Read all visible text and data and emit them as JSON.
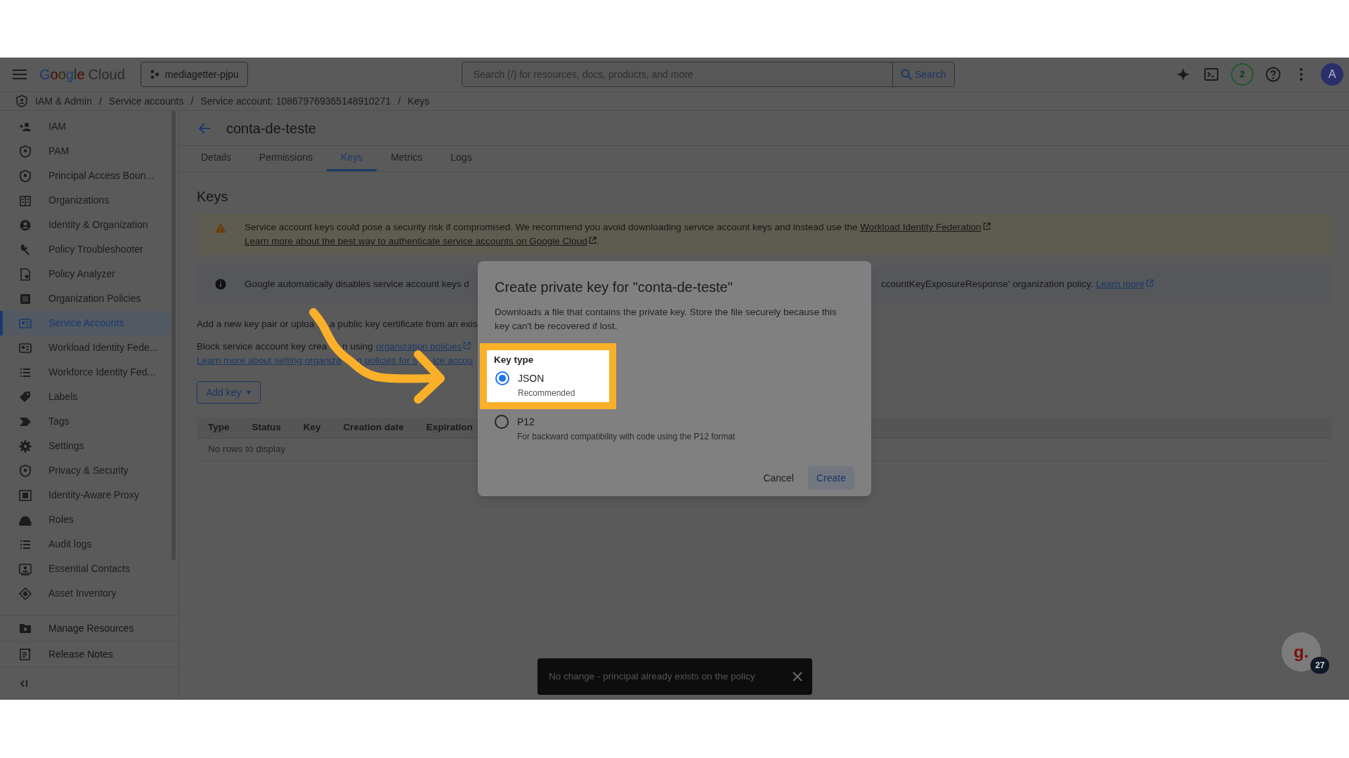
{
  "header": {
    "logo_brand": "Google",
    "logo_product": "Cloud",
    "project": "mediagetter-pjpu",
    "search_placeholder": "Search (/) for resources, docs, products, and more",
    "search_button": "Search",
    "notifications": "2",
    "avatar": "A"
  },
  "breadcrumbs": {
    "separator": "/",
    "items": [
      "IAM & Admin",
      "Service accounts",
      "Service account: 108679769365148910271",
      "Keys"
    ]
  },
  "sidebar": {
    "items": [
      {
        "label": "IAM",
        "selected": false
      },
      {
        "label": "PAM",
        "selected": false
      },
      {
        "label": "Principal Access Boun...",
        "selected": false
      },
      {
        "label": "Organizations",
        "selected": false
      },
      {
        "label": "Identity & Organization",
        "selected": false
      },
      {
        "label": "Policy Troubleshooter",
        "selected": false
      },
      {
        "label": "Policy Analyzer",
        "selected": false
      },
      {
        "label": "Organization Policies",
        "selected": false
      },
      {
        "label": "Service Accounts",
        "selected": true
      },
      {
        "label": "Workload Identity Fede...",
        "selected": false
      },
      {
        "label": "Workforce Identity Fed...",
        "selected": false
      },
      {
        "label": "Labels",
        "selected": false
      },
      {
        "label": "Tags",
        "selected": false
      },
      {
        "label": "Settings",
        "selected": false
      },
      {
        "label": "Privacy & Security",
        "selected": false
      },
      {
        "label": "Identity-Aware Proxy",
        "selected": false
      },
      {
        "label": "Roles",
        "selected": false
      },
      {
        "label": "Audit logs",
        "selected": false
      },
      {
        "label": "Essential Contacts",
        "selected": false
      },
      {
        "label": "Asset Inventory",
        "selected": false
      }
    ],
    "footer": [
      "Manage Resources",
      "Release Notes"
    ]
  },
  "page": {
    "title": "conta-de-teste",
    "tabs": [
      {
        "label": "Details",
        "selected": false
      },
      {
        "label": "Permissions",
        "selected": false
      },
      {
        "label": "Keys",
        "selected": true
      },
      {
        "label": "Metrics",
        "selected": false
      },
      {
        "label": "Logs",
        "selected": false
      }
    ],
    "heading": "Keys",
    "warning": {
      "text": "Service account keys could pose a security risk if compromised. We recommend you avoid downloading service account keys and instead use the",
      "links": [
        "Workload Identity Federation",
        "Learn more about the best way to authenticate service accounts on Google Cloud"
      ],
      "end": "."
    },
    "info": {
      "text_left": "Google automatically disables service account keys d",
      "text_right": "ccountKeyExposureResponse' organization policy.",
      "link": "Learn more"
    },
    "add_text": [
      "Add a new key pair or uploa",
      "a public key certificate from an exis"
    ],
    "block_text": [
      "Block service account key crea",
      "n using"
    ],
    "block_link": "organization policies",
    "learn_link": [
      "Learn more about setting organiza",
      "n policies for s",
      "ice accou"
    ],
    "add_key": "Add key",
    "table": {
      "columns": [
        "Type",
        "Status",
        "Key",
        "Creation date",
        "Expiration"
      ],
      "empty": "No rows to display"
    }
  },
  "dialog": {
    "title": "Create private key for \"conta-de-teste\"",
    "description": "Downloads a file that contains the private key. Store the file securely because this key can't be recovered if lost.",
    "key_type": {
      "label": "Key type",
      "options": [
        {
          "label": "JSON",
          "hint": "Recommended",
          "selected": true,
          "highlighted": true
        },
        {
          "label": "P12",
          "hint": "For backward compatibility with code using the P12 format",
          "selected": false,
          "highlighted": false
        }
      ]
    },
    "buttons": [
      "Cancel",
      "Create"
    ]
  },
  "toast": {
    "text": "No change - principal already exists on the policy"
  },
  "helper": {
    "logo": "g.",
    "badge": "27"
  }
}
